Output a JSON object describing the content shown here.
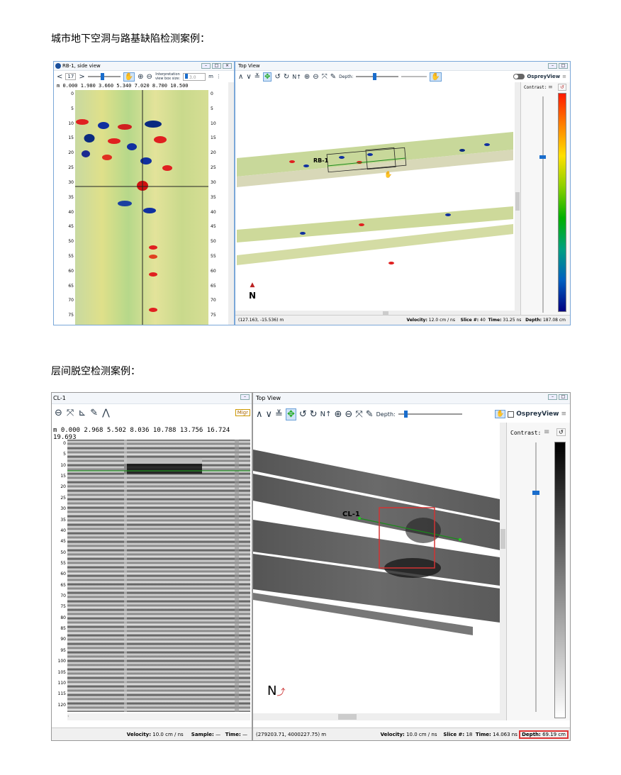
{
  "headings": {
    "section1": "城市地下空洞与路基缺陷检测案例：",
    "section2": "层间脱空检测案例："
  },
  "case1": {
    "side": {
      "title": "RB-1, side view",
      "nav_value": "17",
      "interp_label_1": "Interpretation",
      "interp_label_2": "view box size:",
      "interp_value": "3.0",
      "interp_unit": "m",
      "x_unit": "m",
      "x_ticks": [
        "0.000",
        "1.980",
        "3.660",
        "5.340",
        "7.020",
        "8.700",
        "10.500"
      ],
      "depth_ticks": [
        "0",
        "5",
        "10",
        "15",
        "20",
        "25",
        "30",
        "35",
        "40",
        "45",
        "50",
        "55",
        "60",
        "65",
        "70",
        "75"
      ]
    },
    "top": {
      "title": "Top View",
      "depth_label": "Depth:",
      "app_name": "OspreyView",
      "contrast_label": "Contrast:",
      "line_label": "RB-1",
      "north_label": "N",
      "status": {
        "coords": "(127.163, -15.536) m",
        "velocity_label": "Velocity:",
        "velocity_value": "12.0 cm / ns",
        "slice_label": "Slice #:",
        "slice_value": "40",
        "time_label": "Time:",
        "time_value": "31.25 ns",
        "depth_label": "Depth:",
        "depth_value": "187.08 cm"
      }
    }
  },
  "case2": {
    "side": {
      "title": "CL-1",
      "migrate_label": "Migr",
      "x_unit": "m",
      "x_ticks": [
        "0.000",
        "2.968",
        "5.502",
        "8.036",
        "10.788",
        "13.756",
        "16.724",
        "19.693"
      ],
      "depth_ticks": [
        "0",
        "5",
        "10",
        "15",
        "20",
        "25",
        "30",
        "35",
        "40",
        "45",
        "50",
        "55",
        "60",
        "65",
        "70",
        "75",
        "80",
        "85",
        "90",
        "95",
        "100",
        "105",
        "110",
        "115",
        "120"
      ],
      "status": {
        "velocity_label": "Velocity:",
        "velocity_value": "10.0 cm / ns",
        "sample_label": "Sample:",
        "sample_value": "—",
        "time_label": "Time:"
      }
    },
    "top": {
      "title": "Top View",
      "depth_label": "Depth:",
      "app_name": "OspreyView",
      "contrast_label": "Contrast:",
      "line_label": "CL-1",
      "north_label": "N",
      "status": {
        "coords": "(279203.71, 4000227.75) m",
        "velocity_label": "Velocity:",
        "velocity_value": "10.0 cm / ns",
        "slice_label": "Slice #:",
        "slice_value": "18",
        "time_label": "Time:",
        "time_value": "14.063 ns",
        "depth_label": "Depth:",
        "depth_value": "69.19 cm"
      }
    }
  },
  "icons": [
    "back-icon",
    "forward-icon",
    "hand-icon",
    "zoom-in-icon",
    "zoom-out-icon",
    "fit-icon",
    "pencil-icon",
    "peak-icon",
    "rotate-icon",
    "north-icon",
    "pan-icon",
    "menu-icon",
    "reset-icon"
  ],
  "colors": {
    "frame_border": "#7aa7d8",
    "highlight": "#d33333",
    "accent": "#1a6dcc"
  }
}
